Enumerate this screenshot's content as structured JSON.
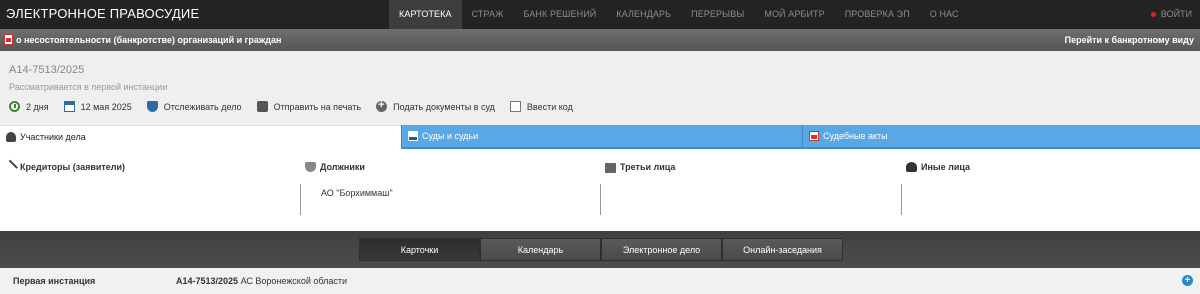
{
  "brand": "ЭЛЕКТРОННОЕ ПРАВОСУДИЕ",
  "nav": [
    {
      "label": "КАРТОТЕКА",
      "active": true
    },
    {
      "label": "СТРАЖ"
    },
    {
      "label": "БАНК РЕШЕНИЙ"
    },
    {
      "label": "КАЛЕНДАРЬ"
    },
    {
      "label": "ПЕРЕРЫВЫ"
    },
    {
      "label": "МОЙ АРБИТР"
    },
    {
      "label": "ПРОВЕРКА ЭП"
    },
    {
      "label": "О НАС"
    }
  ],
  "login": "ВОЙТИ",
  "typebar": {
    "title": "о несостоятельности (банкротстве) организаций и граждан",
    "goto": "Перейти к банкротному виду"
  },
  "case": {
    "number": "А14-7513/2025",
    "status": "Рассматривается в первой инстанции",
    "actions": {
      "days": "2 дня",
      "date": "12 мая 2025",
      "track": "Отслеживать дело",
      "print": "Отправить на печать",
      "submit": "Подать документы в суд",
      "code": "Ввести код"
    }
  },
  "tabs": {
    "participants": "Участники дела",
    "courts": "Суды и судьи",
    "acts": "Судебные акты"
  },
  "participants": {
    "creditors": {
      "title": "Кредиторы (заявители)",
      "items": []
    },
    "debtors": {
      "title": "Должники",
      "items": [
        "АО \"Борхиммаш\""
      ]
    },
    "third": {
      "title": "Третьи лица",
      "items": []
    },
    "others": {
      "title": "Иные лица",
      "items": []
    }
  },
  "bottom_tabs": [
    {
      "label": "Карточки",
      "active": true
    },
    {
      "label": "Календарь"
    },
    {
      "label": "Электронное дело"
    },
    {
      "label": "Онлайн-заседания"
    }
  ],
  "instance": {
    "label": "Первая инстанция",
    "case_number": "А14-7513/2025",
    "court": "АС Воронежской области"
  }
}
